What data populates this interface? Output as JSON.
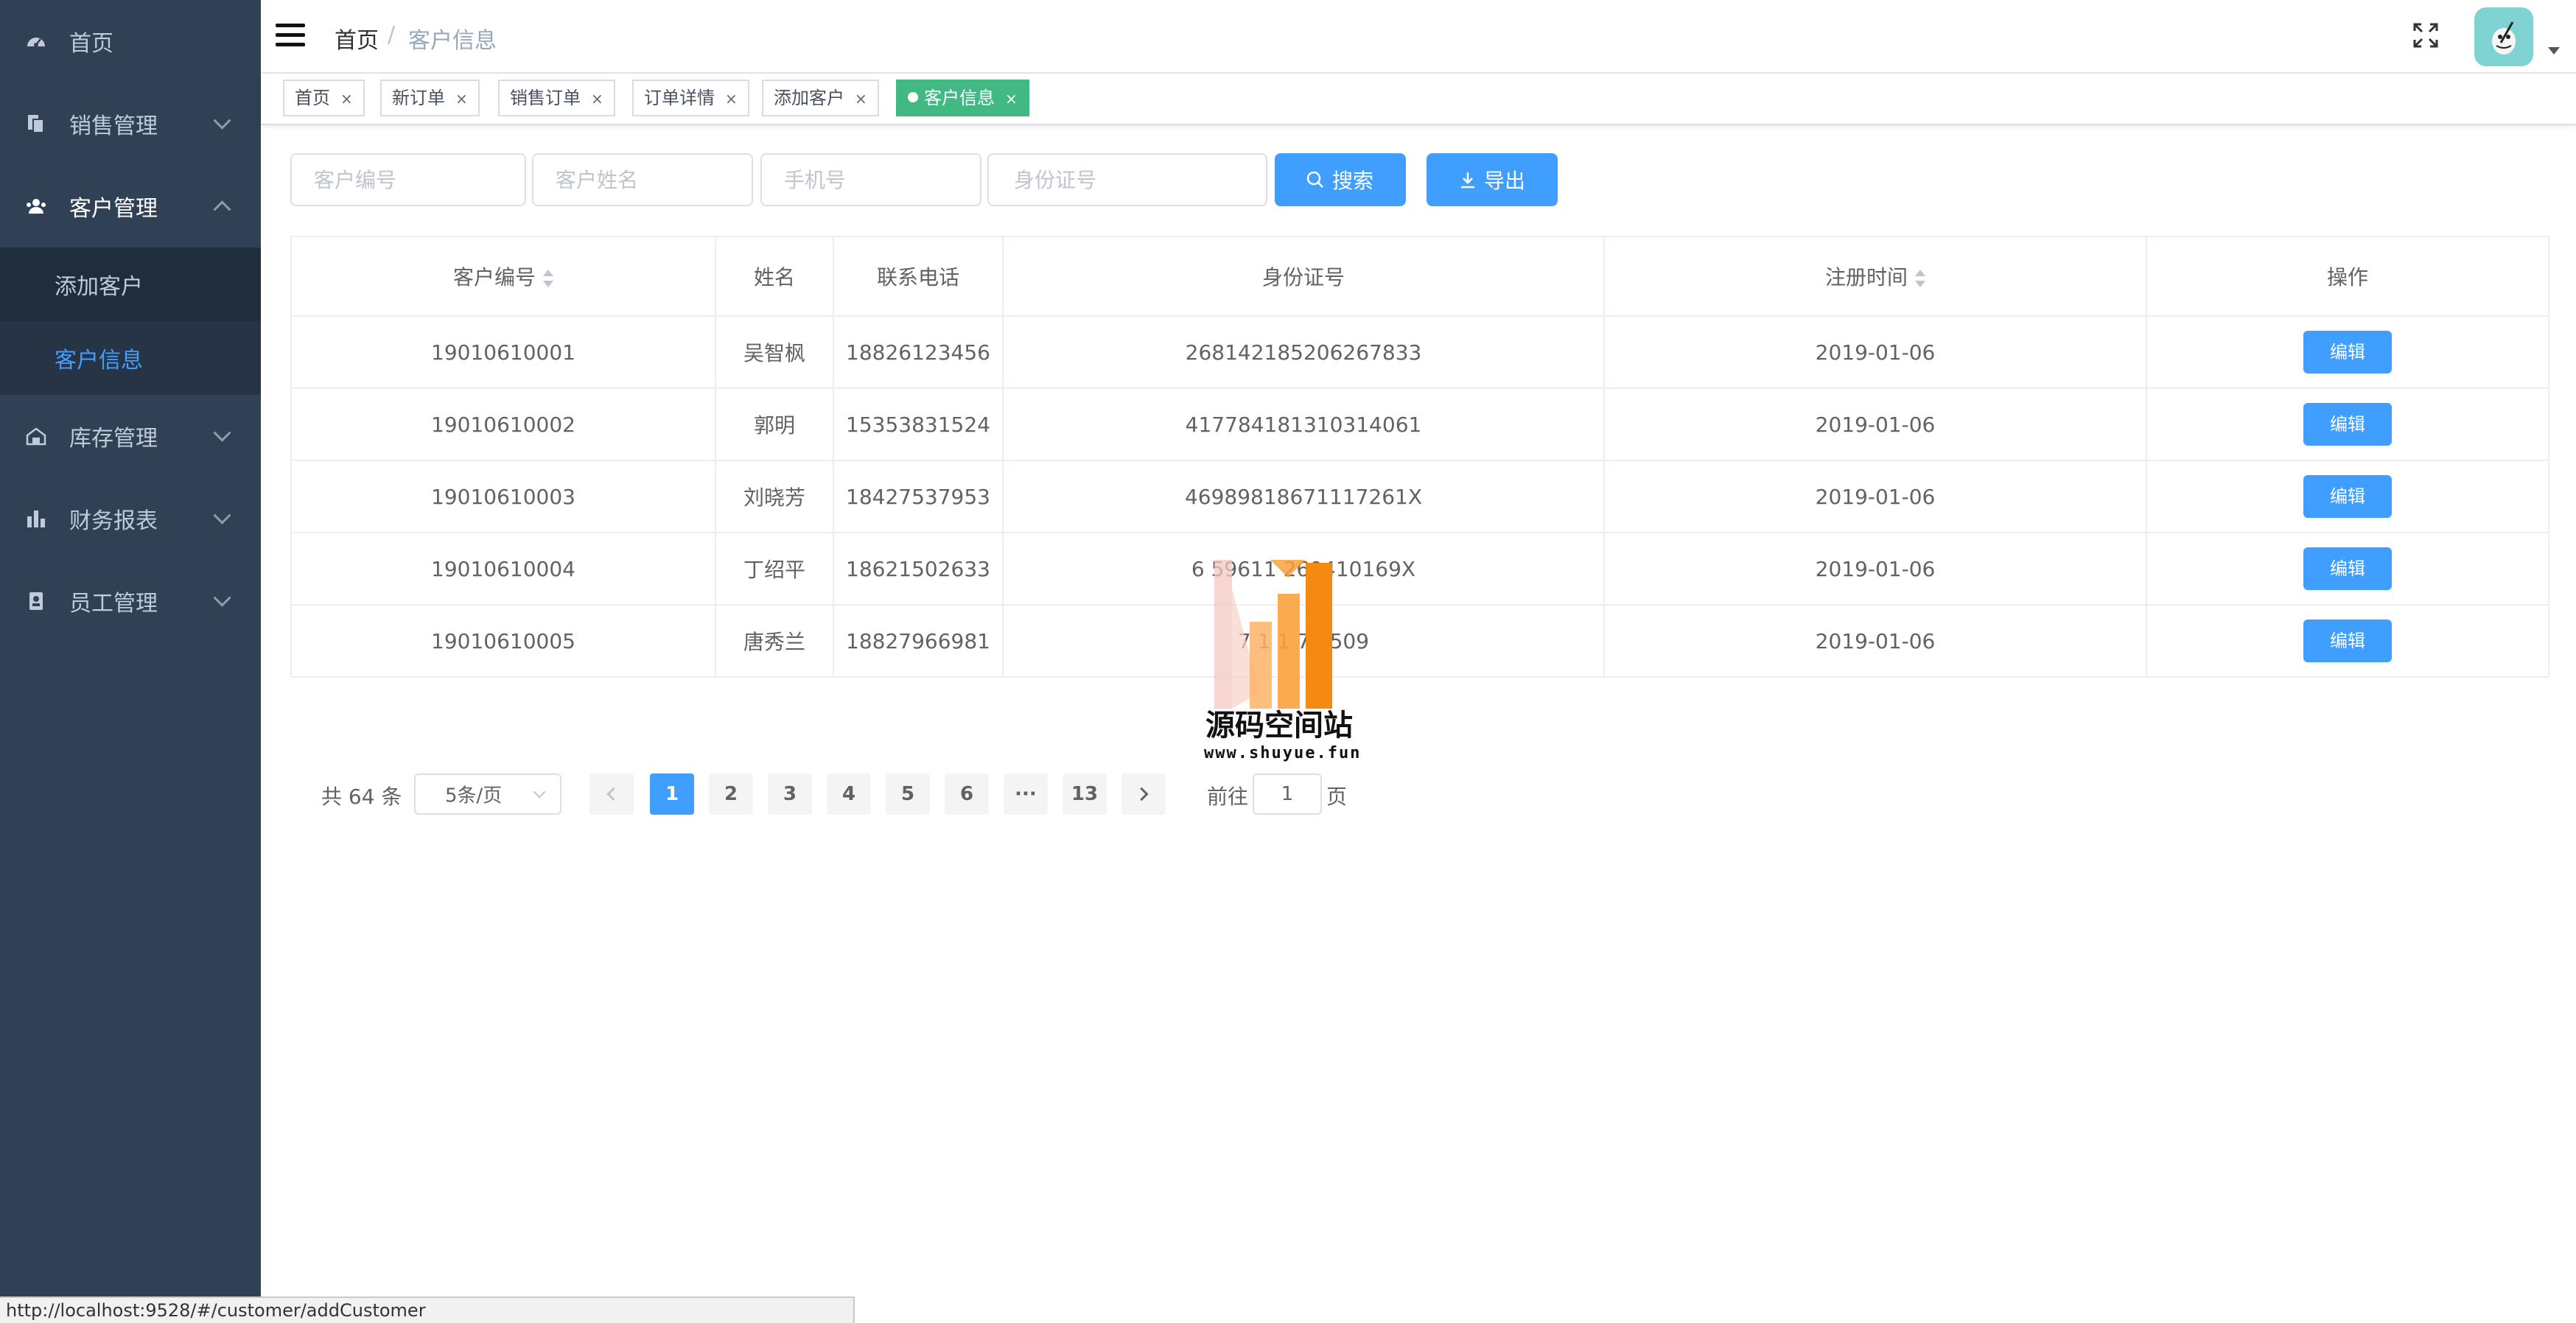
{
  "colors": {
    "sidebar_bg": "#304156",
    "sidebar_text": "#bfcbd9",
    "primary": "#409eff",
    "active_tag": "#42b983"
  },
  "sidebar": {
    "items": [
      {
        "label": "首页",
        "icon": "dashboard-icon"
      },
      {
        "label": "销售管理",
        "icon": "documents-icon"
      },
      {
        "label": "客户管理",
        "icon": "people-icon",
        "expanded": true,
        "children": [
          {
            "label": "添加客户"
          },
          {
            "label": "客户信息",
            "active": true
          }
        ]
      },
      {
        "label": "库存管理",
        "icon": "warehouse-icon"
      },
      {
        "label": "财务报表",
        "icon": "bar-chart-icon"
      },
      {
        "label": "员工管理",
        "icon": "badge-icon"
      }
    ]
  },
  "navbar": {
    "breadcrumb": {
      "home": "首页",
      "separator": "/",
      "current": "客户信息"
    },
    "fullscreen_icon": "fullscreen-icon",
    "avatar_icon": "avatar-icon"
  },
  "tags": [
    {
      "label": "首页",
      "close": "×"
    },
    {
      "label": "新订单",
      "close": "×"
    },
    {
      "label": "销售订单",
      "close": "×"
    },
    {
      "label": "订单详情",
      "close": "×"
    },
    {
      "label": "添加客户",
      "close": "×"
    },
    {
      "label": "客户信息",
      "close": "×",
      "active": true
    }
  ],
  "filters": {
    "customer_id_placeholder": "客户编号",
    "customer_name_placeholder": "客户姓名",
    "phone_placeholder": "手机号",
    "idcard_placeholder": "身份证号",
    "search_label": "搜索",
    "export_label": "导出"
  },
  "table": {
    "columns": [
      "客户编号",
      "姓名",
      "联系电话",
      "身份证号",
      "注册时间",
      "操作"
    ],
    "rows": [
      {
        "id": "19010610001",
        "name": "吴智枫",
        "phone": "18826123456",
        "idcard": "268142185206267833",
        "date": "2019-01-06",
        "action": "编辑"
      },
      {
        "id": "19010610002",
        "name": "郭明",
        "phone": "15353831524",
        "idcard": "417784181310314061",
        "date": "2019-01-06",
        "action": "编辑"
      },
      {
        "id": "19010610003",
        "name": "刘晓芳",
        "phone": "18427537953",
        "idcard": "46989818671117261X",
        "date": "2019-01-06",
        "action": "编辑"
      },
      {
        "id": "19010610004",
        "name": "丁绍平",
        "phone": "18621502633",
        "idcard": "6 59611 260410169X",
        "date": "2019-01-06",
        "action": "编辑"
      },
      {
        "id": "19010610005",
        "name": "唐秀兰",
        "phone": "18827966981",
        "idcard": "7 1 1 7 5509",
        "date": "2019-01-06",
        "action": "编辑"
      }
    ]
  },
  "pagination": {
    "total": "共 64 条",
    "page_size": "5条/页",
    "pages": [
      "1",
      "2",
      "3",
      "4",
      "5",
      "6",
      "···",
      "13"
    ],
    "current": "1",
    "goto_prefix": "前往",
    "goto_value": "1",
    "goto_suffix": "页"
  },
  "watermark": {
    "title": "源码空间站",
    "url": "www.shuyue.fun"
  },
  "statusbar": {
    "url": "http://localhost:9528/#/customer/addCustomer"
  }
}
